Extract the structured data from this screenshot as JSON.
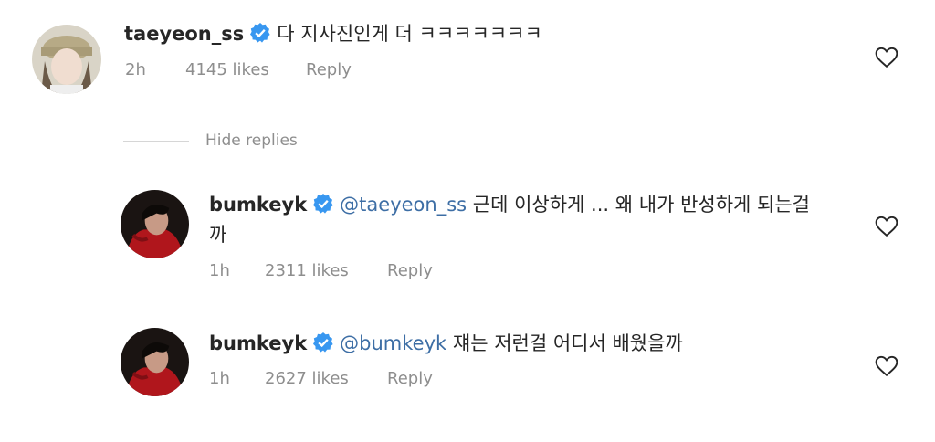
{
  "comments": [
    {
      "username": "taeyeon_ss",
      "mention": "",
      "text": "다 지사진인게 더 ㅋㅋㅋㅋㅋㅋㅋ",
      "text_cont": "",
      "time": "2h",
      "likes": "4145 likes",
      "reply": "Reply",
      "avatar_icon": "profile-photo"
    },
    {
      "username": "bumkeyk",
      "mention": "@taeyeon_ss",
      "text": "근데 이상하게 ... 왜 내가 반성하게 되는걸",
      "text_cont": "까",
      "time": "1h",
      "likes": "2311 likes",
      "reply": "Reply",
      "avatar_icon": "profile-photo"
    },
    {
      "username": "bumkeyk",
      "mention": "@bumkeyk",
      "text": "쟤는 저런걸 어디서 배웠을까",
      "text_cont": "",
      "time": "1h",
      "likes": "2627 likes",
      "reply": "Reply",
      "avatar_icon": "profile-photo"
    }
  ],
  "hide_replies": "Hide replies",
  "icons": {
    "verified": "verified-badge-icon",
    "like": "heart-outline-icon"
  },
  "colors": {
    "mention": "#3d6ea5",
    "meta": "#8e8e8e",
    "verified": "#3897f0"
  }
}
